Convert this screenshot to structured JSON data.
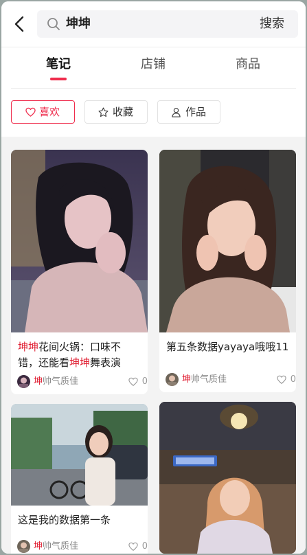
{
  "search": {
    "query": "坤坤",
    "button_label": "搜索"
  },
  "tabs": [
    {
      "label": "笔记",
      "active": true
    },
    {
      "label": "店铺",
      "active": false
    },
    {
      "label": "商品",
      "active": false
    }
  ],
  "filters": [
    {
      "label": "喜欢",
      "icon": "heart-icon",
      "active": true
    },
    {
      "label": "收藏",
      "icon": "star-icon",
      "active": false
    },
    {
      "label": "作品",
      "icon": "person-icon",
      "active": false
    }
  ],
  "colors": {
    "accent": "#ef2d4d",
    "highlight": "#e01b2f"
  },
  "cards": [
    {
      "title_parts": [
        {
          "text": "坤坤",
          "hl": true
        },
        {
          "text": "花间火锅：口味不错，还能看",
          "hl": false
        },
        {
          "text": "坤坤",
          "hl": true
        },
        {
          "text": "舞表演",
          "hl": false
        }
      ],
      "author_hl": "坤",
      "author_rest": "帅气质佳",
      "likes": "0"
    },
    {
      "title_parts": [
        {
          "text": "第五条数据yayaya哦哦11",
          "hl": false
        }
      ],
      "author_hl": "坤",
      "author_rest": "帅气质佳",
      "likes": "0"
    },
    {
      "title_parts": [
        {
          "text": "这是我的数据第一条",
          "hl": false
        }
      ],
      "author_hl": "坤",
      "author_rest": "帅气质佳",
      "likes": "0"
    },
    {
      "title_parts": [],
      "author_hl": "",
      "author_rest": "",
      "likes": ""
    }
  ]
}
